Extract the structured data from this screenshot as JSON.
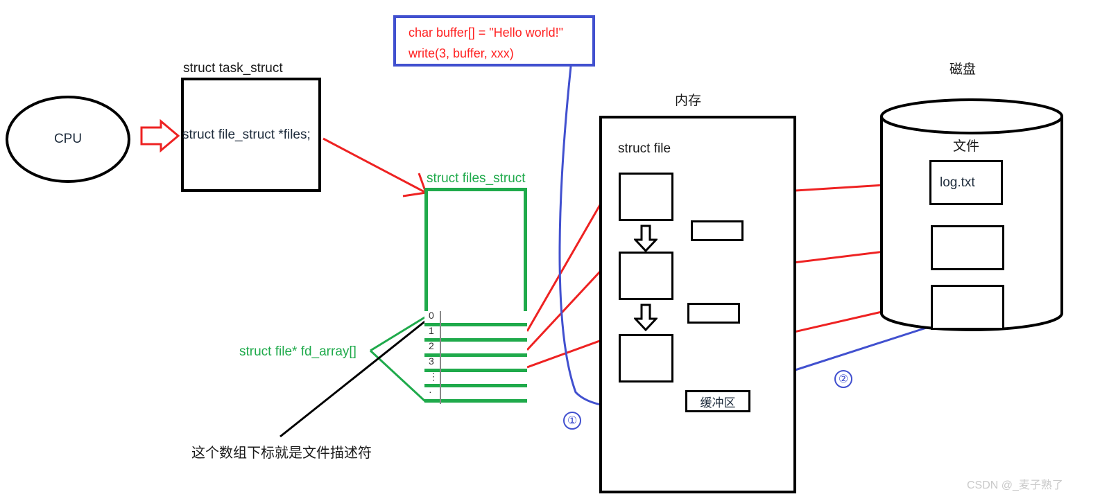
{
  "diagram": {
    "title": "Linux file descriptor / write() flow diagram",
    "colors": {
      "red": "#ee2222",
      "green": "#1faa4b",
      "blue": "#4150cf",
      "black": "#000000",
      "watermark_gray": "#c9c9c9"
    }
  },
  "cpu": {
    "label": "CPU"
  },
  "task_struct": {
    "title": "struct task_struct",
    "field": "struct file_struct *files;"
  },
  "code": {
    "line1": "char buffer[] = \"Hello world!\"",
    "line2": "write(3, buffer, xxx)"
  },
  "files_struct": {
    "title": "struct files_struct",
    "array_label": "struct file* fd_array[]",
    "rows": [
      {
        "index": "0"
      },
      {
        "index": "1"
      },
      {
        "index": "2"
      },
      {
        "index": "3"
      },
      {
        "index": "⋮"
      },
      {
        "index": "·"
      },
      {
        "index": ""
      }
    ],
    "note": "这个数组下标就是文件描述符"
  },
  "memory": {
    "title": "内存",
    "struct_file_label": "struct file",
    "buffer_label": "缓冲区"
  },
  "disk": {
    "title": "磁盘",
    "files_label": "文件",
    "files": [
      {
        "name": "log.txt"
      },
      {
        "name": ""
      },
      {
        "name": ""
      }
    ]
  },
  "markers": {
    "step1": "①",
    "step2": "②"
  },
  "watermark": {
    "text": "CSDN @_麦子熟了"
  }
}
